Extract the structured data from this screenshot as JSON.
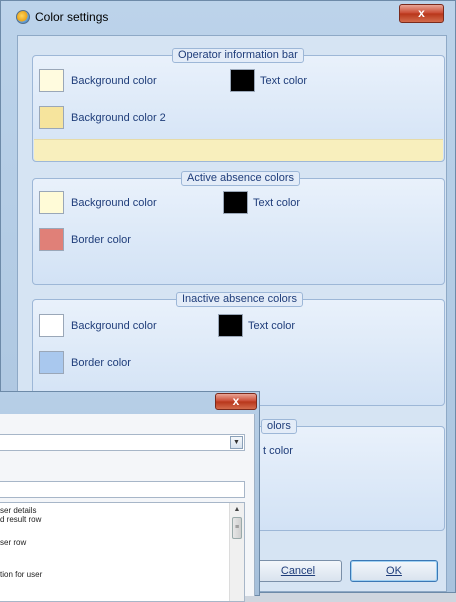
{
  "dialog": {
    "title": "Color settings",
    "close_label": "x",
    "groups": [
      {
        "legend": "Operator information bar",
        "background_label": "Background color",
        "background_color": "#fffbdf",
        "text_label": "Text color",
        "text_color": "#000000",
        "second_label": "Background color 2",
        "second_color": "#f6e49d",
        "preview_color": "#f8efbd"
      },
      {
        "legend": "Active absence colors",
        "background_label": "Background color",
        "background_color": "#fffbd7",
        "text_label": "Text color",
        "text_color": "#000000",
        "second_label": "Border color",
        "second_color": "#e08078"
      },
      {
        "legend": "Inactive absence colors",
        "background_label": "Background color",
        "background_color": "#ffffff",
        "text_label": "Text color",
        "text_color": "#000000",
        "second_label": "Border color",
        "second_color": "#a9c8ee"
      },
      {
        "legend_partial": "olors",
        "text_label_partial": "t color"
      }
    ],
    "buttons": {
      "cancel": "Cancel",
      "ok": "OK"
    }
  },
  "overlay_window": {
    "close_label": "x",
    "combo_arrow": "▼",
    "list_items": [
      "ser details",
      "d result row",
      "ser row",
      "tion for user"
    ],
    "scroll_up": "▲",
    "scroll_grip": "≡"
  }
}
